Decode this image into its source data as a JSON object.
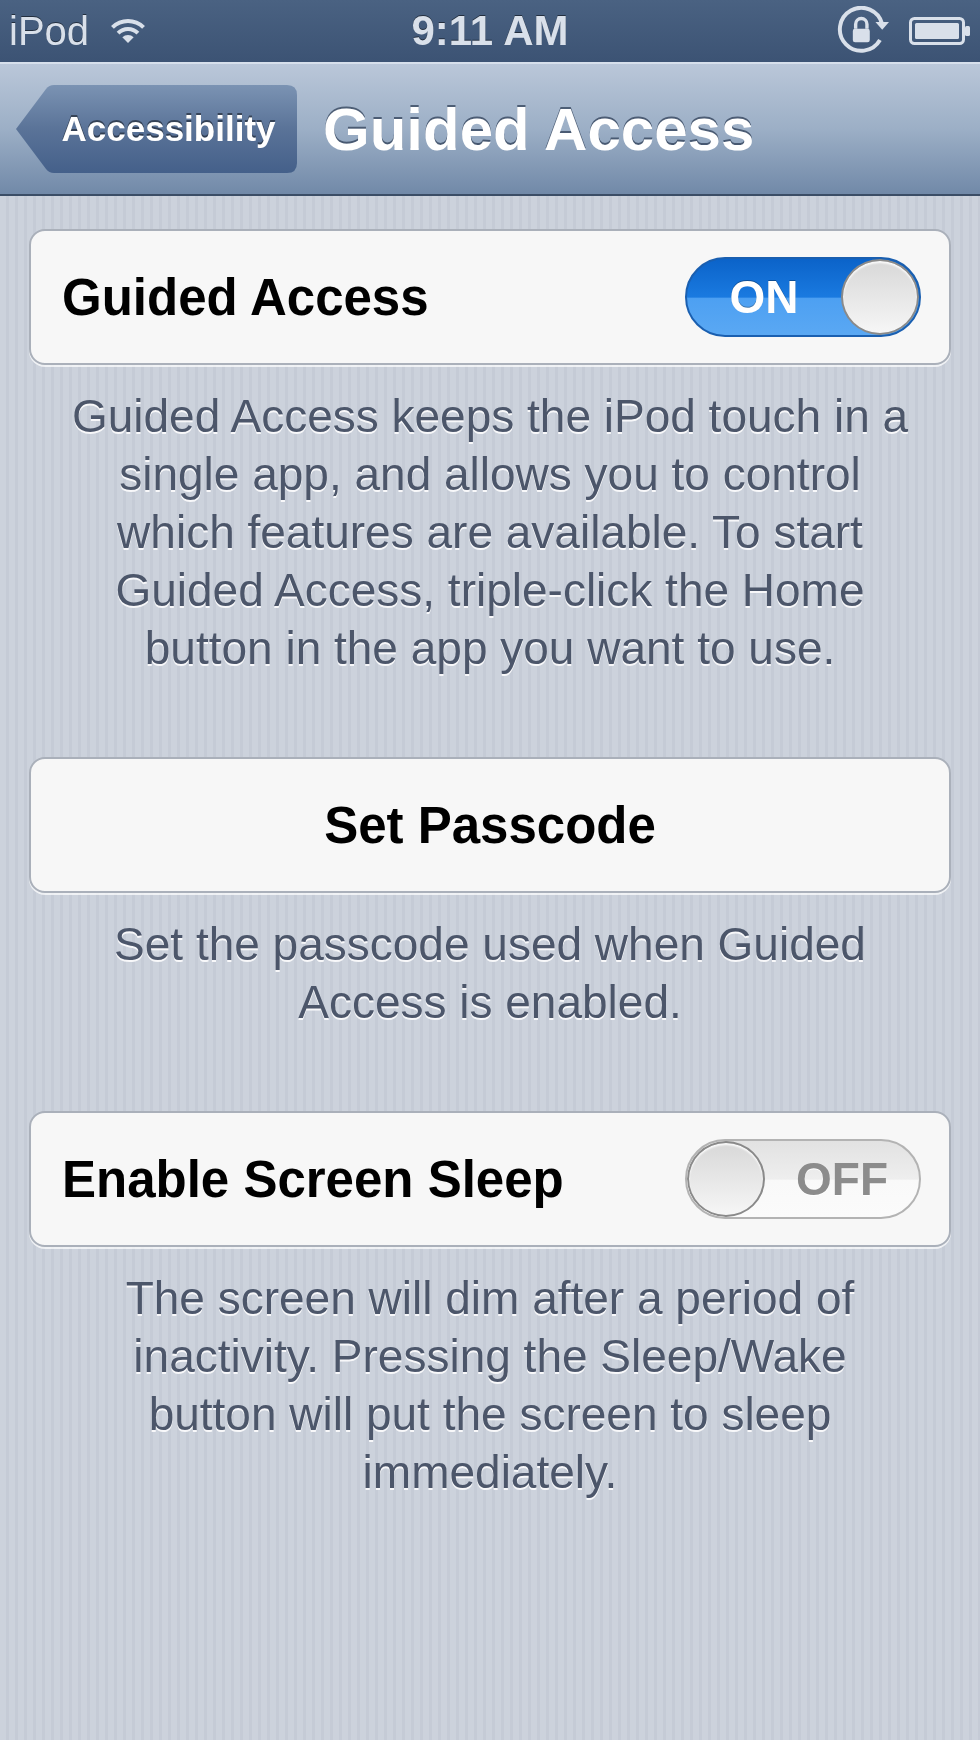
{
  "status_bar": {
    "carrier": "iPod",
    "time": "9:11 AM"
  },
  "nav_bar": {
    "back_button": "Accessibility",
    "title": "Guided Access"
  },
  "sections": [
    {
      "kind": "toggle",
      "label": "Guided Access",
      "on": true,
      "state_label": "ON",
      "footer": "Guided Access keeps the iPod touch in a single app, and allows you to control which features are available. To start Guided Access, triple-click the Home button in the app you want to use."
    },
    {
      "kind": "button",
      "label": "Set Passcode",
      "footer": "Set the passcode used when Guided Access is enabled."
    },
    {
      "kind": "toggle",
      "label": "Enable Screen Sleep",
      "on": false,
      "state_label": "OFF",
      "footer": "The screen will dim after a period of inactivity. Pressing the Sleep/Wake button will put the screen to sleep immediately."
    }
  ]
}
